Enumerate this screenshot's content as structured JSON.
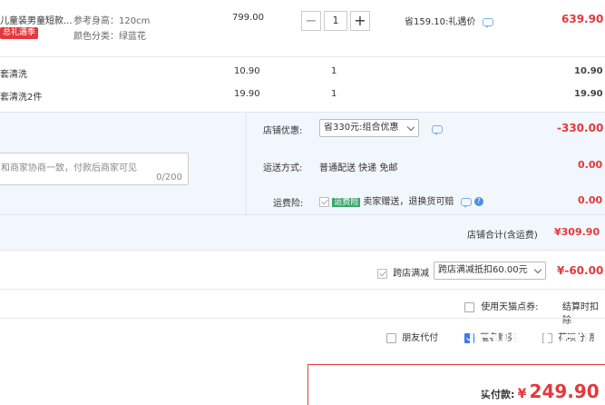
{
  "product": {
    "title": "儿童装男童短款...",
    "badge": "总礼遇季",
    "spec1": "参考身高：120cm",
    "spec2": "颜色分类：绿蓝花",
    "unit_price": "799.00",
    "qty": "1",
    "qty_minus": "−",
    "qty_plus": "+",
    "discount_text": "省159.10:礼遇价",
    "subtotal": "639.90"
  },
  "addons": [
    {
      "name": "套清洗",
      "price": "10.90",
      "qty": "1",
      "subtotal": "10.90"
    },
    {
      "name": "套清洗2件",
      "price": "19.90",
      "qty": "1",
      "subtotal": "19.90"
    }
  ],
  "message": {
    "placeholder_text": "和商家协商一致，付款后商家可见",
    "counter": "0/200"
  },
  "store": {
    "discount_label": "店铺优惠:",
    "discount_select": "省330元:组合优惠",
    "discount_amount": "-330.00",
    "shipping_label": "运送方式:",
    "shipping_text": "普通配送 快递 免邮",
    "shipping_amount": "0.00",
    "insurance_label": "运费险:",
    "insurance_badge": "运费险",
    "insurance_text": "卖家赠送，退换货可赔",
    "insurance_amount": "0.00",
    "total_label": "店铺合计(含运费)",
    "total_amount": "¥309.90"
  },
  "cross_store": {
    "label": "跨店满减",
    "select": "跨店满减抵扣60.00元",
    "amount": "¥-60.00"
  },
  "tmall_points": {
    "label": "使用天猫点券:",
    "note": "结算时扣除"
  },
  "options": {
    "friend_pay": "朋友代付",
    "anon_buy": "匿名购买",
    "installments": "花呗分期"
  },
  "payment": {
    "label": "实付款:",
    "currency": "¥",
    "amount": "249.90"
  },
  "watermark": {
    "logo": "值",
    "site": "zhi"
  },
  "colors": {
    "accent_red": "#e4393c",
    "panel_blue": "#f2f6fd",
    "check_blue": "#3b7de9",
    "insurance_green": "#3aa76d"
  }
}
